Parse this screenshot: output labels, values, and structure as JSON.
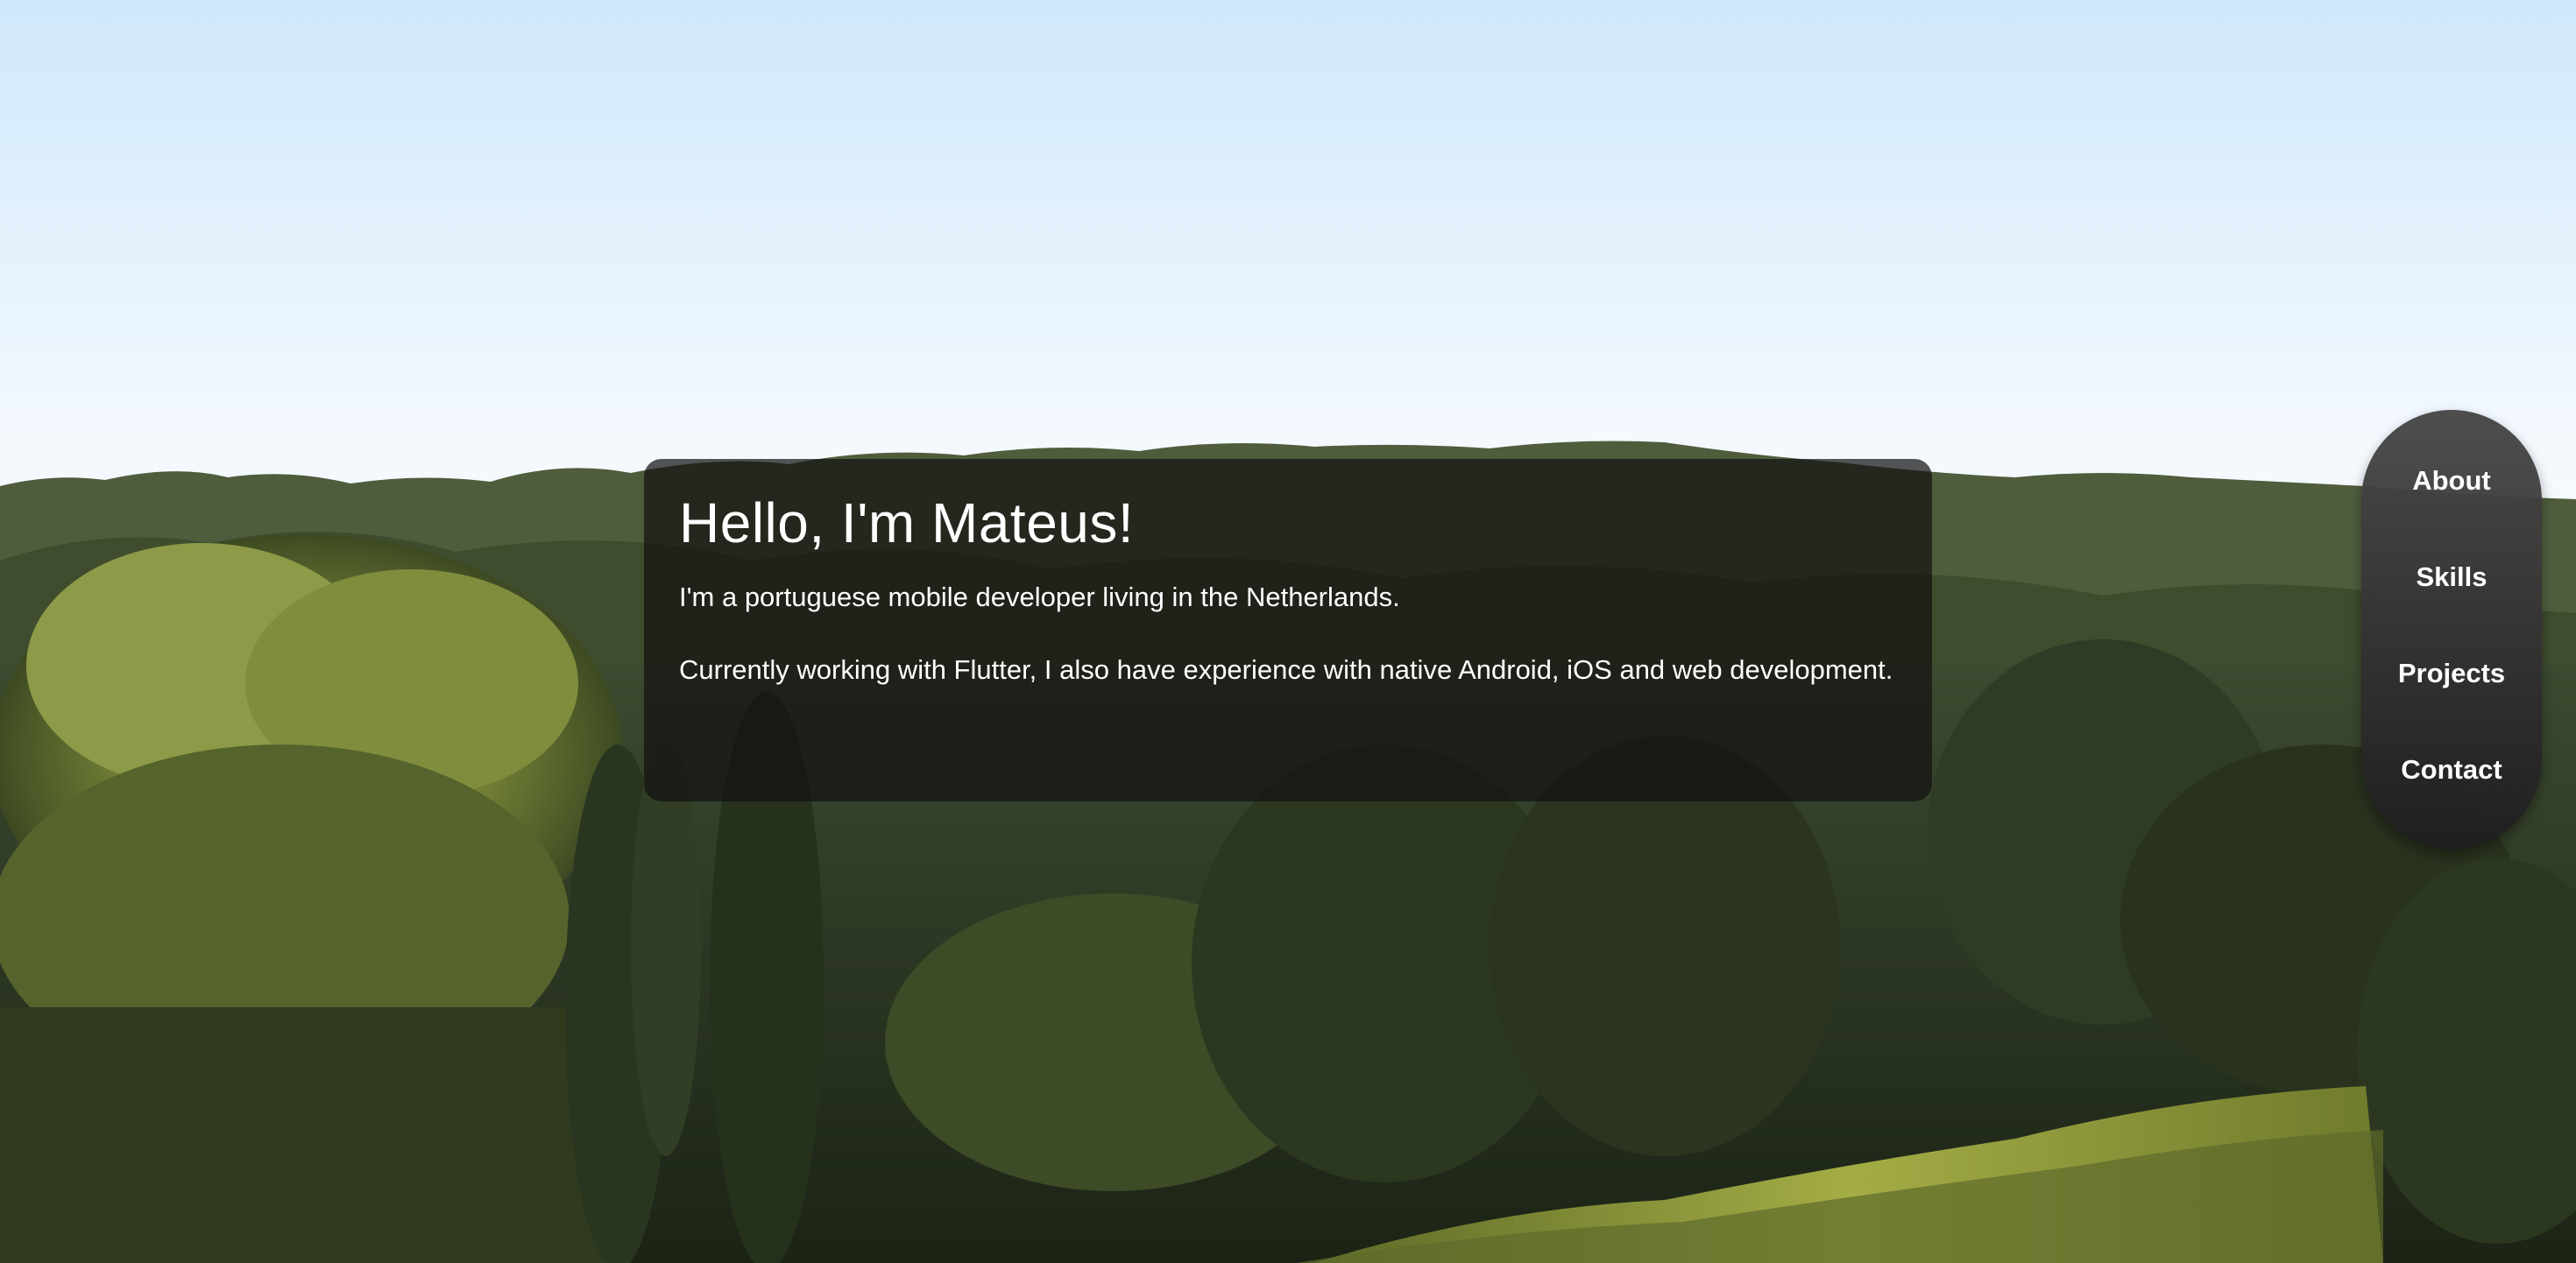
{
  "hero": {
    "title": "Hello, I'm Mateus!",
    "intro": "I'm a portuguese mobile developer living in the Netherlands.",
    "experience": "Currently working with Flutter, I also have experience with native Android, iOS and web development."
  },
  "nav": {
    "items": [
      {
        "label": "About"
      },
      {
        "label": "Skills"
      },
      {
        "label": "Projects"
      },
      {
        "label": "Contact"
      }
    ]
  },
  "colors": {
    "card_background": "#121212",
    "nav_background": "#3a3a3a",
    "text": "#ffffff",
    "sky": "#ffffff",
    "forest": "#2e3a24"
  },
  "background": {
    "subject": "forest-landscape-photo"
  }
}
